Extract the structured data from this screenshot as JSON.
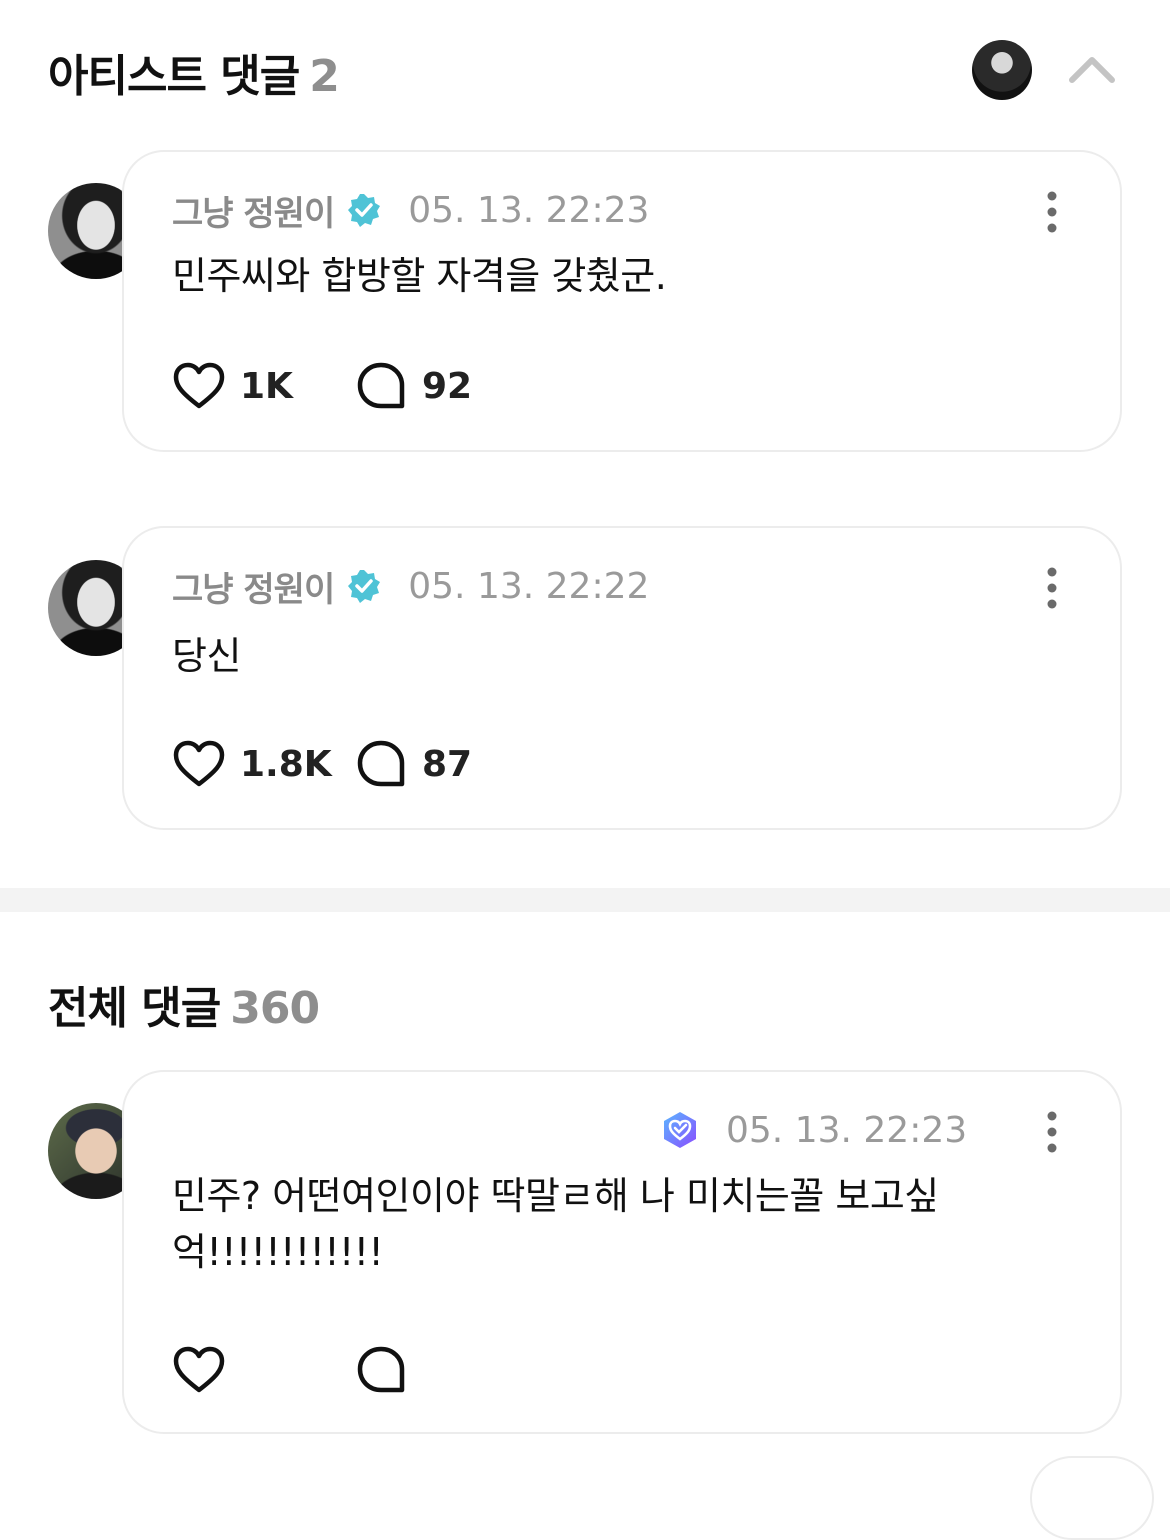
{
  "artist_section": {
    "title": "아티스트 댓글",
    "count": "2"
  },
  "all_section": {
    "title": "전체 댓글",
    "count": "360"
  },
  "comments": [
    {
      "author": "그냥 정원이",
      "time": "05. 13. 22:23",
      "text": "민주씨와 합방할 자격을 갖췄군.",
      "likes": "1K",
      "replies": "92"
    },
    {
      "author": "그냥 정원이",
      "time": "05. 13. 22:22",
      "text": "당신",
      "likes": "1.8K",
      "replies": "87"
    },
    {
      "author": "",
      "time": "05. 13. 22:23",
      "text": "민주? 어떤여인이야 딱말ㄹ해 나 미치는꼴 보고싶억!!!!!!!!!!!!",
      "likes": "",
      "replies": ""
    }
  ],
  "colors": {
    "verified_badge": "#4fc3d6",
    "fan_badge": "#6c63ff",
    "meta_gray": "#9a9a9a",
    "card_border": "#ececec",
    "divider": "#f3f3f3"
  },
  "icons": {
    "collapse": "chevron-up-icon",
    "more": "more-vertical-icon",
    "like": "heart-icon",
    "reply": "speech-bubble-icon",
    "verified": "verified-badge-icon",
    "fan": "fan-badge-icon"
  }
}
